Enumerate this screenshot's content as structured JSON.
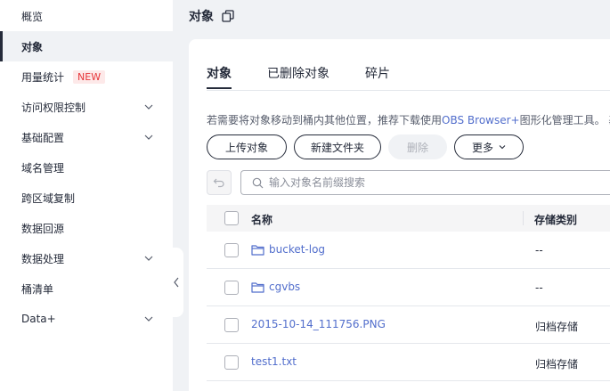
{
  "sidebar": {
    "items": [
      {
        "label": "概览"
      },
      {
        "label": "对象"
      },
      {
        "label": "用量统计",
        "badge": "NEW"
      },
      {
        "label": "访问权限控制"
      },
      {
        "label": "基础配置"
      },
      {
        "label": "域名管理"
      },
      {
        "label": "跨区域复制"
      },
      {
        "label": "数据回源"
      },
      {
        "label": "数据处理"
      },
      {
        "label": "桶清单"
      },
      {
        "label": "Data+"
      }
    ]
  },
  "header": {
    "title": "对象"
  },
  "tabs": [
    {
      "label": "对象"
    },
    {
      "label": "已删除对象"
    },
    {
      "label": "碎片"
    }
  ],
  "tip": {
    "prefix": "若需要将对象移动到桶内其他位置，推荐下载使用",
    "link": "OBS Browser+",
    "suffix": "图形化管理工具。 基"
  },
  "toolbar": {
    "upload": "上传对象",
    "new_folder": "新建文件夹",
    "delete": "删除",
    "more": "更多"
  },
  "search": {
    "placeholder": "输入对象名前缀搜索"
  },
  "table": {
    "columns": {
      "name": "名称",
      "storage_class": "存储类别"
    },
    "rows": [
      {
        "name": "bucket-log",
        "storage_class": "--",
        "type": "folder"
      },
      {
        "name": "cgvbs",
        "storage_class": "--",
        "type": "folder"
      },
      {
        "name": "2015-10-14_111756.PNG",
        "storage_class": "归档存储",
        "type": "file"
      },
      {
        "name": "test1.txt",
        "storage_class": "归档存储",
        "type": "file"
      }
    ]
  },
  "colors": {
    "accent": "#526ecc",
    "badge": "#e6363a",
    "text": "#252b3a"
  }
}
